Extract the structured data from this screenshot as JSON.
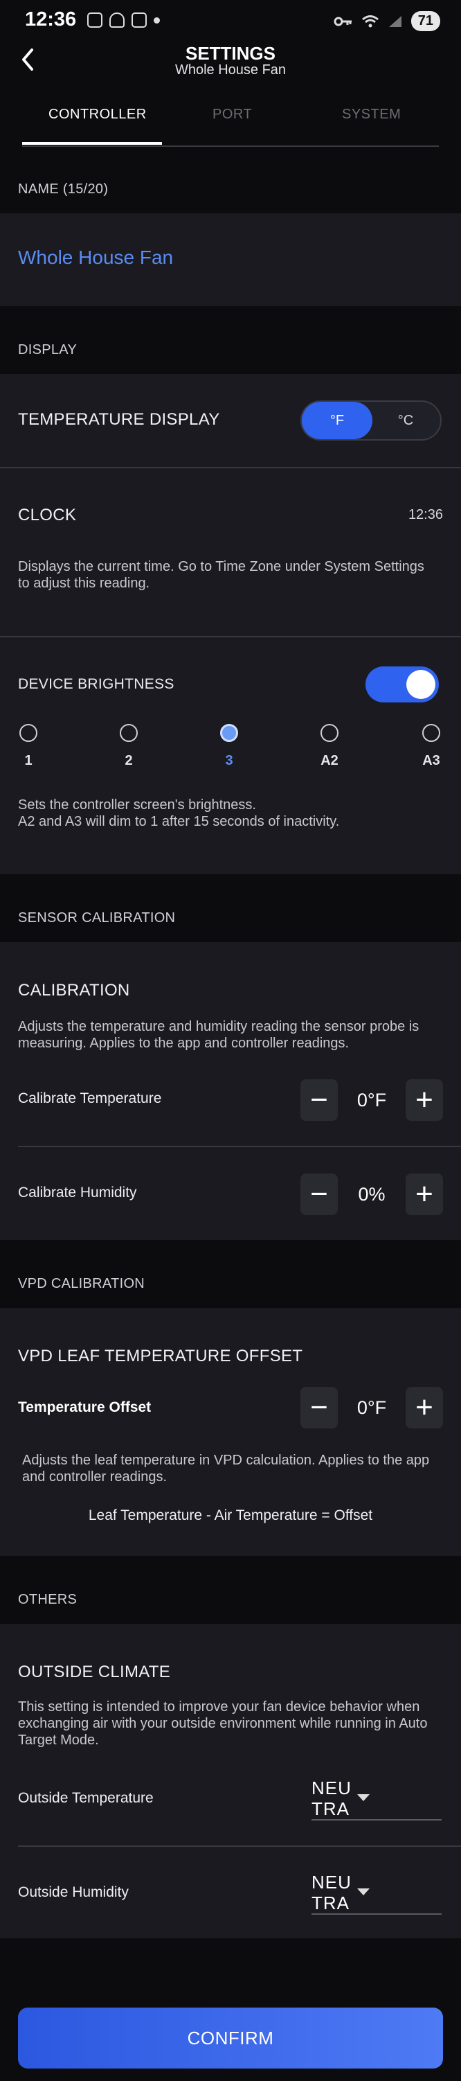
{
  "status_bar": {
    "time": "12:36",
    "battery": "71"
  },
  "header": {
    "title": "SETTINGS",
    "subtitle": "Whole House Fan"
  },
  "tabs": [
    {
      "label": "CONTROLLER",
      "active": true
    },
    {
      "label": "PORT",
      "active": false
    },
    {
      "label": "SYSTEM",
      "active": false
    }
  ],
  "name_section": {
    "label": "NAME (15/20)",
    "value": "Whole House Fan"
  },
  "display": {
    "section_label": "DISPLAY",
    "temperature_display": {
      "label": "TEMPERATURE DISPLAY",
      "option_f": "°F",
      "option_c": "°C",
      "selected": "°F"
    },
    "clock": {
      "label": "CLOCK",
      "value": "12:36",
      "description": "Displays the current time. Go to Time Zone under System Settings to adjust this reading."
    },
    "brightness": {
      "label": "DEVICE BRIGHTNESS",
      "enabled": true,
      "options": [
        "1",
        "2",
        "3",
        "A2",
        "A3"
      ],
      "selected": "3",
      "description_line1": "Sets the controller screen's brightness.",
      "description_line2": "A2 and A3 will dim to 1 after 15 seconds of inactivity."
    }
  },
  "sensor_calibration": {
    "section_label": "SENSOR CALIBRATION",
    "title": "CALIBRATION",
    "description": "Adjusts the temperature and humidity reading the sensor probe is measuring. Applies to the app and controller readings.",
    "temperature": {
      "label": "Calibrate Temperature",
      "value": "0°F"
    },
    "humidity": {
      "label": "Calibrate Humidity",
      "value": "0%"
    }
  },
  "vpd_calibration": {
    "section_label": "VPD CALIBRATION",
    "title": "VPD LEAF TEMPERATURE OFFSET",
    "offset": {
      "label": "Temperature Offset",
      "value": "0°F"
    },
    "description": "Adjusts the leaf temperature in VPD calculation. Applies to the app and controller readings.",
    "formula": "Leaf Temperature - Air Temperature = Offset"
  },
  "others": {
    "section_label": "OTHERS",
    "title": "OUTSIDE CLIMATE",
    "description": "This setting is intended to improve your fan device behavior when exchanging air with your outside environment while running in Auto Target Mode.",
    "outside_temperature": {
      "label": "Outside Temperature",
      "value": "NEUTRAL"
    },
    "outside_humidity": {
      "label": "Outside Humidity",
      "value": "NEUTRAL"
    }
  },
  "confirm_label": "CONFIRM",
  "colors": {
    "accent": "#2f62ee",
    "name_text": "#5b8cf0",
    "background": "#0c0c0e",
    "card": "#1a1a20"
  }
}
